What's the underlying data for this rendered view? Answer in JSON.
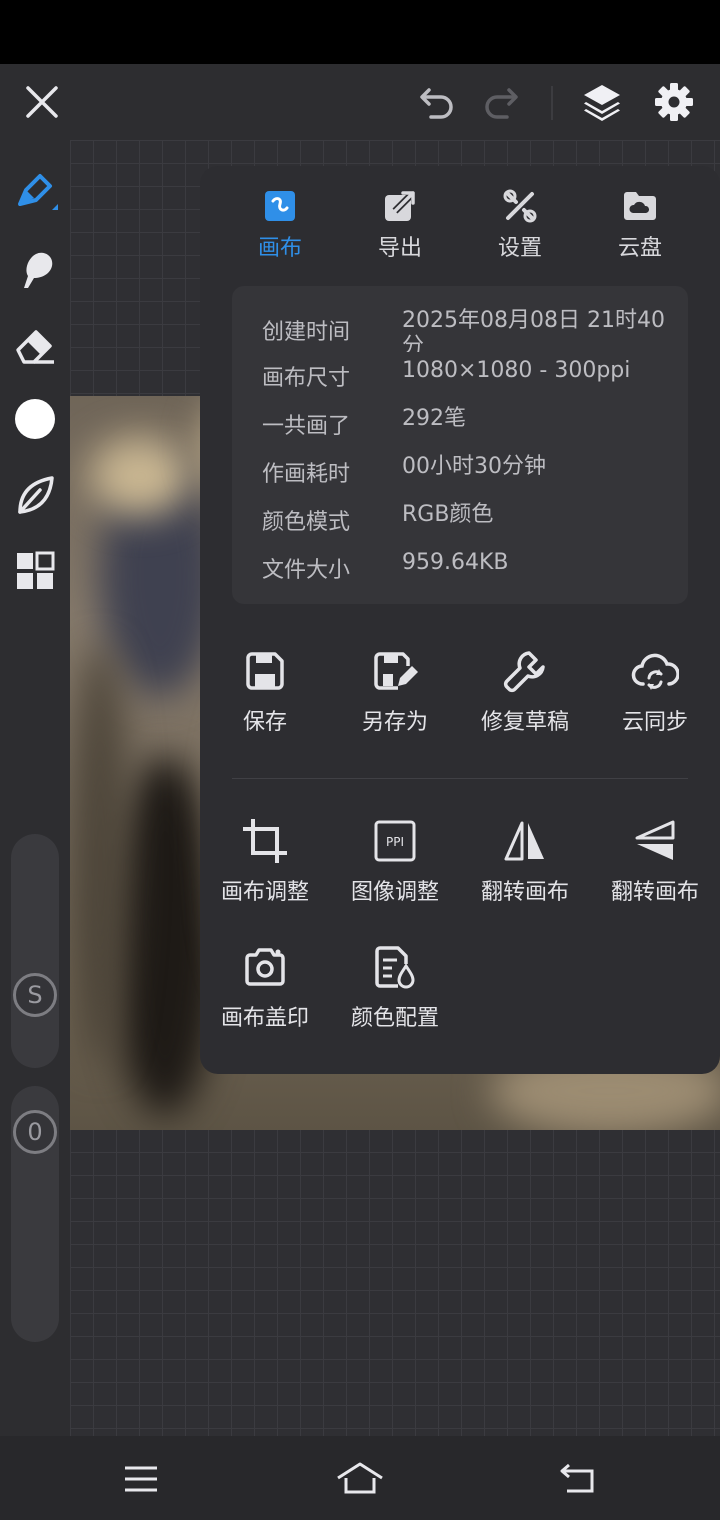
{
  "tabs": [
    {
      "label": "画布",
      "icon": "canvas-icon",
      "active": true
    },
    {
      "label": "导出",
      "icon": "export-icon",
      "active": false
    },
    {
      "label": "设置",
      "icon": "tools-icon",
      "active": false
    },
    {
      "label": "云盘",
      "icon": "cloud-folder-icon",
      "active": false
    }
  ],
  "info": [
    {
      "label": "创建时间",
      "value": "2025年08月08日 21时40分"
    },
    {
      "label": "画布尺寸",
      "value": "1080×1080 - 300ppi"
    },
    {
      "label": "一共画了",
      "value": "292笔"
    },
    {
      "label": "作画耗时",
      "value": "00小时30分钟"
    },
    {
      "label": "颜色模式",
      "value": "RGB颜色"
    },
    {
      "label": "文件大小",
      "value": "959.64KB"
    }
  ],
  "actions_row1": [
    {
      "label": "保存",
      "icon": "save-icon"
    },
    {
      "label": "另存为",
      "icon": "save-as-icon"
    },
    {
      "label": "修复草稿",
      "icon": "wrench-icon"
    },
    {
      "label": "云同步",
      "icon": "cloud-sync-icon"
    }
  ],
  "actions_row2": [
    {
      "label": "画布调整",
      "icon": "crop-icon"
    },
    {
      "label": "图像调整",
      "icon": "ppi-icon"
    },
    {
      "label": "翻转画布",
      "icon": "flip-horizontal-icon"
    },
    {
      "label": "翻转画布",
      "icon": "flip-vertical-icon"
    }
  ],
  "actions_row3": [
    {
      "label": "画布盖印",
      "icon": "camera-icon"
    },
    {
      "label": "颜色配置",
      "icon": "color-profile-icon"
    }
  ],
  "sliders": {
    "size_label": "S",
    "opacity_label": "0"
  },
  "colors": {
    "accent": "#2f8fe8",
    "current_brush_color": "#ffffff"
  }
}
